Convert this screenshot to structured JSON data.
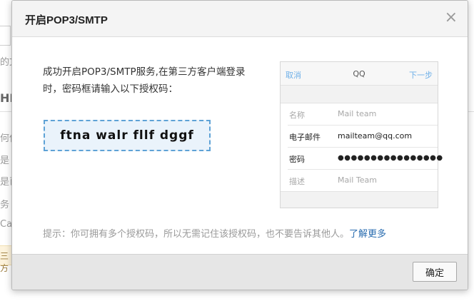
{
  "background": {
    "fragments": [
      "的文",
      "HD",
      "何使",
      "是",
      "是已",
      "务 (",
      "Cau",
      "三方"
    ]
  },
  "dialog": {
    "title": "开启POP3/SMTP",
    "close_glyph": "×",
    "intro": "成功开启POP3/SMTP服务,在第三方客户端登录时，密码框请输入以下授权码：",
    "auth_code": "ftna walr fllf dggf",
    "mock": {
      "nav": {
        "cancel": "取消",
        "title": "QQ",
        "next": "下一步"
      },
      "rows": [
        {
          "key": "名称",
          "value": "Mail team"
        },
        {
          "key": "电子邮件",
          "value": "mailteam@qq.com"
        },
        {
          "key": "密码",
          "value": "●●●●●●●●●●●●●●●●"
        },
        {
          "key": "描述",
          "value": "Mail Team"
        }
      ]
    },
    "tip": "提示：你可拥有多个授权码，所以无需记住该授权码，也不要告诉其他人。",
    "tip_link": "了解更多",
    "ok_label": "确定"
  }
}
